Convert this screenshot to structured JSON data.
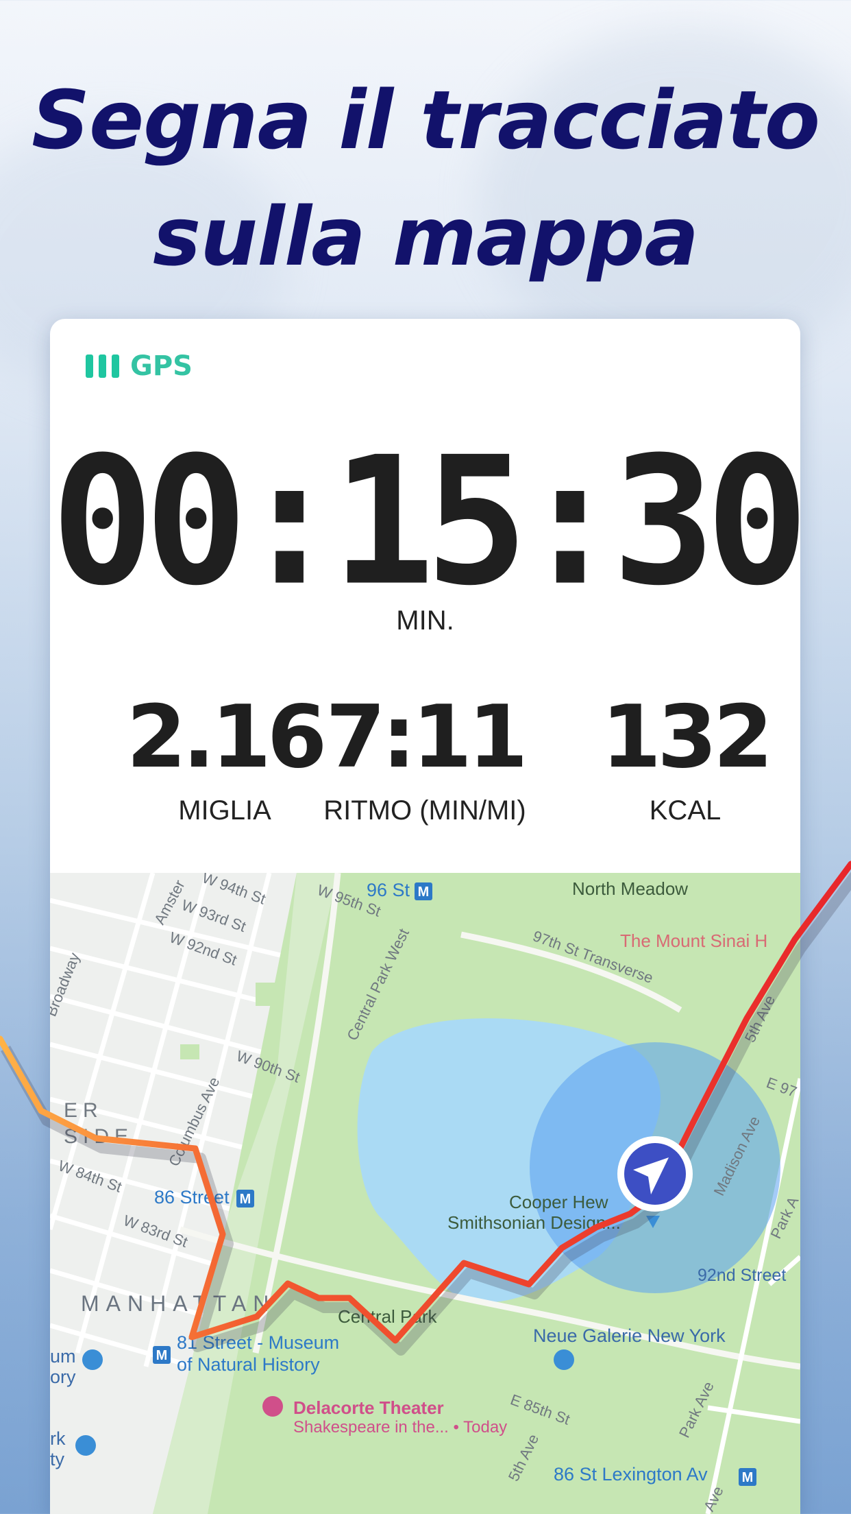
{
  "headline": {
    "line1": "Segna il tracciato",
    "line2": "sulla mappa"
  },
  "gps": {
    "label": "GPS",
    "icon": "gps-signal-bars-icon"
  },
  "timer": {
    "value": "00:15:30",
    "unit": "MIN."
  },
  "stats": [
    {
      "value": "2.16",
      "label": "MIGLIA"
    },
    {
      "value": "7:11",
      "label": "RITMO (MIN/MI)"
    },
    {
      "value": "132",
      "label": "KCAL"
    }
  ],
  "map": {
    "labels": {
      "station_96st": "96 St",
      "north_meadow": "North Meadow",
      "mount_sinai": "The Mount Sinai H",
      "transverse_97": "97th St Transverse",
      "amsterdam": "Amster",
      "w94": "W 94th St",
      "w93": "W 93rd St",
      "w92": "W 92nd St",
      "w95": "W 95th St",
      "broadway": "Broadway",
      "cpw": "Central Park West",
      "w90": "W 90th St",
      "columbus": "Columbus Ave",
      "fifth": "5th Ave",
      "e97": "E 97",
      "upper_west": "ER",
      "side": "SIDE",
      "w84": "W 84th St",
      "station_86": "86 Street",
      "w83": "W 83rd St",
      "cooper_hewitt_1": "Cooper Hew",
      "cooper_hewitt_2": "Smithsonian Design...",
      "madison": "Madison Ave",
      "park_ave": "Park A",
      "street_92": "92nd Street",
      "manhattan": "MANHATTAN",
      "central_park": "Central Park",
      "museum_1": "81 Street - Museum",
      "museum_2": "of Natural History",
      "neue_galerie": "Neue Galerie New York",
      "um": "um",
      "ory": "ory",
      "rk": "rk",
      "ty": "ty",
      "delacorte_1": "Delacorte Theater",
      "delacorte_2": "Shakespeare in the... • Today",
      "e85": "E 85th St",
      "fifth_b": "5th Ave",
      "park_ave_b": "Park Ave",
      "lexington": "86 St Lexington Av",
      "ave_b": "Ave"
    }
  },
  "colors": {
    "headline": "#12126b",
    "gps_accent": "#1fc6a0",
    "route_start": "#ffb347",
    "route_end": "#e8262b",
    "location": "#3d4fc4"
  }
}
